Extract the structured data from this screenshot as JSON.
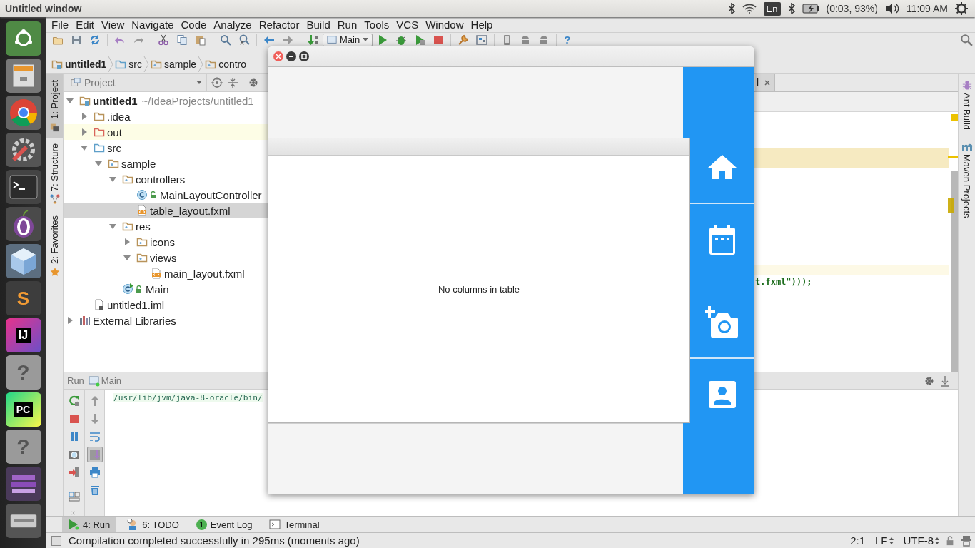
{
  "top_panel": {
    "title": "Untitled window",
    "indicators": [
      {
        "kind": "bluetooth"
      },
      {
        "kind": "wifi"
      },
      {
        "kind": "keyboard",
        "text": "En"
      },
      {
        "kind": "bluetooth"
      },
      {
        "kind": "battery"
      },
      {
        "kind": "text",
        "text": "(0:03, 93%)"
      },
      {
        "kind": "volume"
      },
      {
        "kind": "text",
        "text": "11:09 AM"
      },
      {
        "kind": "power"
      }
    ]
  },
  "launcher": [
    {
      "kind": "dash"
    },
    {
      "kind": "files"
    },
    {
      "kind": "browser"
    },
    {
      "kind": "settings"
    },
    {
      "kind": "terminal"
    },
    {
      "kind": "onion"
    },
    {
      "kind": "cube"
    },
    {
      "kind": "editor",
      "glyph": "S"
    },
    {
      "kind": "ide",
      "glyph": "IJ"
    },
    {
      "kind": "unknown",
      "glyph": "?"
    },
    {
      "kind": "ide2",
      "glyph": "PC"
    },
    {
      "kind": "unknown",
      "glyph": "?"
    },
    {
      "kind": "stack"
    },
    {
      "kind": "drive"
    }
  ],
  "menu": [
    "File",
    "Edit",
    "View",
    "Navigate",
    "Code",
    "Analyze",
    "Refactor",
    "Build",
    "Run",
    "Tools",
    "VCS",
    "Window",
    "Help"
  ],
  "toolbar": {
    "run_config": "Main",
    "help": "?"
  },
  "breadcrumbs": [
    {
      "label": "untitled1",
      "kind": "module"
    },
    {
      "label": "src",
      "kind": "source_folder"
    },
    {
      "label": "sample",
      "kind": "package"
    },
    {
      "label": "contro",
      "kind": "package"
    }
  ],
  "left_stripe": [
    {
      "label": "1: Project",
      "kind": "project",
      "selected": true
    },
    {
      "label": "7: Structure",
      "kind": "structure",
      "selected": false
    },
    {
      "label": "2: Favorites",
      "kind": "favorites",
      "selected": false
    }
  ],
  "project_panel": {
    "title": "Project",
    "tree": [
      {
        "name": "untitled1",
        "path": "~/IdeaProjects/untitled1",
        "kind": "module",
        "expanded": true,
        "selected": false,
        "children": [
          {
            "name": ".idea",
            "kind": "folder",
            "expanded": false,
            "selected": false
          },
          {
            "name": "out",
            "kind": "excluded_folder",
            "expanded": false,
            "selected": false
          },
          {
            "name": "src",
            "kind": "source_folder",
            "expanded": true,
            "selected": false,
            "children": [
              {
                "name": "sample",
                "kind": "package",
                "expanded": true,
                "selected": false,
                "children": [
                  {
                    "name": "controllers",
                    "kind": "package",
                    "expanded": true,
                    "selected": false,
                    "children": [
                      {
                        "name": "MainLayoutController",
                        "kind": "class",
                        "selected": false
                      },
                      {
                        "name": "table_layout.fxml",
                        "kind": "fxml",
                        "selected": true
                      }
                    ]
                  },
                  {
                    "name": "res",
                    "kind": "package",
                    "expanded": true,
                    "selected": false,
                    "children": [
                      {
                        "name": "icons",
                        "kind": "package",
                        "expanded": false,
                        "selected": false
                      },
                      {
                        "name": "views",
                        "kind": "package",
                        "expanded": true,
                        "selected": false,
                        "children": [
                          {
                            "name": "main_layout.fxml",
                            "kind": "fxml",
                            "selected": false
                          }
                        ]
                      }
                    ]
                  },
                  {
                    "name": "Main",
                    "kind": "main_class",
                    "selected": false
                  }
                ]
              }
            ]
          },
          {
            "name": "untitled1.iml",
            "kind": "iml",
            "selected": false
          }
        ]
      },
      {
        "name": "External Libraries",
        "kind": "libraries",
        "expanded": false,
        "selected": false
      }
    ]
  },
  "editor": {
    "tab": "l",
    "code_line": "t.fxml\")));"
  },
  "right_stripe": [
    {
      "label": "Ant Build",
      "kind": "ant"
    },
    {
      "label": "Maven Projects",
      "kind": "maven"
    }
  ],
  "run_panel": {
    "title": "Run",
    "config": "Main",
    "console_line": "/usr/lib/jvm/java-8-oracle/bin/"
  },
  "bottom_tabs": [
    {
      "label": "4: Run",
      "kind": "run",
      "selected": true
    },
    {
      "label": "6: TODO",
      "kind": "todo",
      "selected": false
    },
    {
      "label": "Event Log",
      "kind": "event_log",
      "badge": "1",
      "selected": false
    },
    {
      "label": "Terminal",
      "kind": "terminal",
      "selected": false
    }
  ],
  "status_bar": {
    "message": "Compilation completed successfully in 295ms (moments ago)",
    "position": "2:1",
    "line_separator": "LF",
    "encoding": "UTF-8"
  },
  "app_window": {
    "table_placeholder": "No columns in table",
    "nav": [
      {
        "kind": "home"
      },
      {
        "kind": "calendar"
      },
      {
        "kind": "add_photo"
      },
      {
        "kind": "contact"
      }
    ]
  }
}
